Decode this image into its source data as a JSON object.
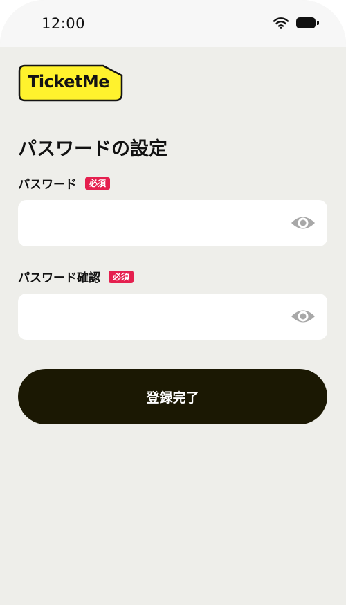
{
  "status_bar": {
    "time": "12:00",
    "wifi_icon": "wifi-icon",
    "battery_icon": "battery-icon"
  },
  "brand": {
    "logo_text": "TicketMe",
    "logo_color": "#fff22d"
  },
  "page": {
    "title": "パスワードの設定"
  },
  "form": {
    "password": {
      "label": "パスワード",
      "badge": "必須",
      "value": "",
      "toggle_icon": "eye-icon"
    },
    "password_confirm": {
      "label": "パスワード確認",
      "badge": "必須",
      "value": "",
      "toggle_icon": "eye-icon"
    },
    "submit_label": "登録完了"
  },
  "colors": {
    "background": "#eeeeea",
    "button": "#1b1803",
    "required_badge": "#e5204f",
    "icon_gray": "#a8a8a8"
  }
}
